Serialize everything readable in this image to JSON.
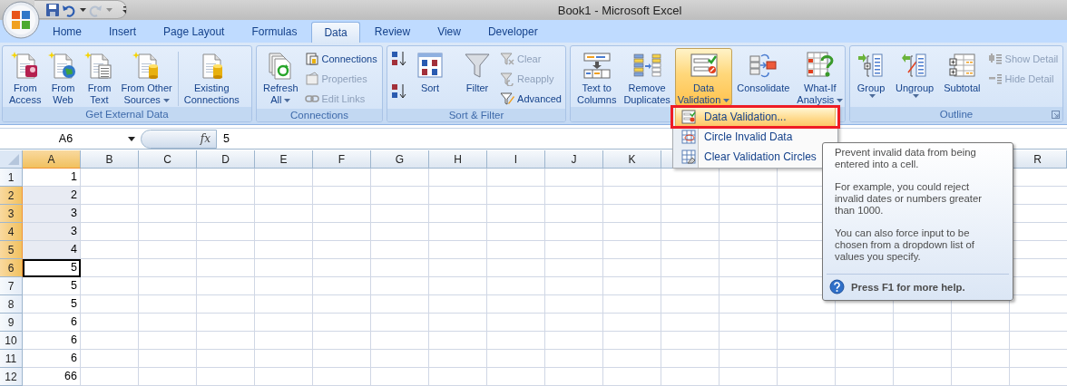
{
  "window": {
    "title": "Book1  -  Microsoft Excel"
  },
  "quick_access": [
    {
      "disabled": false
    },
    {
      "disabled": false
    },
    {
      "disabled": true
    }
  ],
  "tabs": [
    {
      "label": "Home",
      "selected": false
    },
    {
      "label": "Insert",
      "selected": false
    },
    {
      "label": "Page Layout",
      "selected": false
    },
    {
      "label": "Formulas",
      "selected": false
    },
    {
      "label": "Data",
      "selected": true
    },
    {
      "label": "Review",
      "selected": false
    },
    {
      "label": "View",
      "selected": false
    },
    {
      "label": "Developer",
      "selected": false
    }
  ],
  "ribbon": {
    "groups": [
      {
        "label": "Get External Data",
        "buttons": [
          {
            "kind": "large",
            "label": "From\nAccess",
            "dropdown": false,
            "pressed": false
          },
          {
            "kind": "large",
            "label": "From\nWeb",
            "dropdown": false,
            "pressed": false
          },
          {
            "kind": "large",
            "label": "From\nText",
            "dropdown": false,
            "pressed": false
          },
          {
            "kind": "large",
            "label": "From Other\nSources",
            "dropdown": true,
            "pressed": false
          },
          {
            "kind": "separator"
          },
          {
            "kind": "large",
            "label": "Existing\nConnections",
            "dropdown": false,
            "pressed": false
          }
        ]
      },
      {
        "label": "Connections",
        "buttons": [
          {
            "kind": "large",
            "label": "Refresh\nAll",
            "dropdown": true,
            "pressed": false
          },
          {
            "kind": "stack",
            "items": [
              {
                "label": "Connections",
                "disabled": false
              },
              {
                "label": "Properties",
                "disabled": true
              },
              {
                "label": "Edit Links",
                "disabled": true
              }
            ]
          }
        ]
      },
      {
        "label": "Sort & Filter",
        "buttons": [
          {
            "kind": "sortpair"
          },
          {
            "kind": "large",
            "label": "Sort",
            "dropdown": false,
            "pressed": false
          },
          {
            "kind": "separator"
          },
          {
            "kind": "large",
            "label": "Filter",
            "dropdown": false,
            "pressed": false
          },
          {
            "kind": "stack",
            "items": [
              {
                "label": "Clear",
                "disabled": true
              },
              {
                "label": "Reapply",
                "disabled": true
              },
              {
                "label": "Advanced",
                "disabled": false
              }
            ]
          }
        ]
      },
      {
        "buttons": [
          {
            "kind": "large",
            "label": "Text to\nColumns",
            "dropdown": false,
            "pressed": false
          },
          {
            "kind": "large",
            "label": "Remove\nDuplicates",
            "dropdown": false,
            "pressed": false
          },
          {
            "kind": "large",
            "label": "Data\nValidation",
            "dropdown": true,
            "pressed": true
          },
          {
            "kind": "large",
            "label": "Consolidate",
            "dropdown": false,
            "pressed": false
          },
          {
            "kind": "large",
            "label": "What-If\nAnalysis",
            "dropdown": true,
            "pressed": false
          }
        ]
      },
      {
        "label": "Outline",
        "launcher": true,
        "buttons": [
          {
            "kind": "large",
            "label": "Group",
            "dropdown": true,
            "pressed": false
          },
          {
            "kind": "large",
            "label": "Ungroup",
            "dropdown": true,
            "pressed": false
          },
          {
            "kind": "large",
            "label": "Subtotal",
            "dropdown": false,
            "pressed": false
          },
          {
            "kind": "stack",
            "items": [
              {
                "label": "Show Detail",
                "disabled": true
              },
              {
                "label": "Hide Detail",
                "disabled": true
              }
            ]
          }
        ]
      }
    ]
  },
  "formula_bar": {
    "name_box": "A6",
    "function_label": "fx",
    "value": "5"
  },
  "sheet": {
    "columns": [
      {
        "label": "A",
        "selected": true
      },
      {
        "label": "B",
        "selected": false
      },
      {
        "label": "C",
        "selected": false
      },
      {
        "label": "D",
        "selected": false
      },
      {
        "label": "E",
        "selected": false
      },
      {
        "label": "F",
        "selected": false
      },
      {
        "label": "G",
        "selected": false
      },
      {
        "label": "H",
        "selected": false
      },
      {
        "label": "I",
        "selected": false
      },
      {
        "label": "J",
        "selected": false
      },
      {
        "label": "K",
        "selected": false
      },
      {
        "label": "R",
        "selected": false
      }
    ],
    "rows": [
      {
        "label": "1",
        "value": "1",
        "selected": false,
        "active": false
      },
      {
        "label": "2",
        "value": "2",
        "selected": true,
        "active": false
      },
      {
        "label": "3",
        "value": "3",
        "selected": true,
        "active": false
      },
      {
        "label": "4",
        "value": "3",
        "selected": true,
        "active": false
      },
      {
        "label": "5",
        "value": "4",
        "selected": true,
        "active": false
      },
      {
        "label": "6",
        "value": "5",
        "selected": true,
        "active": true
      },
      {
        "label": "7",
        "value": "5",
        "selected": false,
        "active": false
      },
      {
        "label": "8",
        "value": "5",
        "selected": false,
        "active": false
      },
      {
        "label": "9",
        "value": "6",
        "selected": false,
        "active": false
      },
      {
        "label": "10",
        "value": "6",
        "selected": false,
        "active": false
      },
      {
        "label": "11",
        "value": "6",
        "selected": false,
        "active": false
      },
      {
        "label": "12",
        "value": "66",
        "selected": false,
        "active": false
      }
    ]
  },
  "dropdown_menu": {
    "items": [
      {
        "label": "Data Validation...",
        "highlighted": true,
        "callout": true
      },
      {
        "label": "Circle Invalid Data",
        "highlighted": false,
        "callout": false
      },
      {
        "label": "Clear Validation Circles",
        "highlighted": false,
        "callout": false
      }
    ]
  },
  "tooltip": {
    "paragraphs": [
      "Prevent invalid data from being entered into a cell.",
      "For example, you could reject invalid dates or numbers greater than 1000.",
      "You can also force input to be chosen from a dropdown list of values you specify."
    ],
    "help": "Press F1 for more help."
  }
}
